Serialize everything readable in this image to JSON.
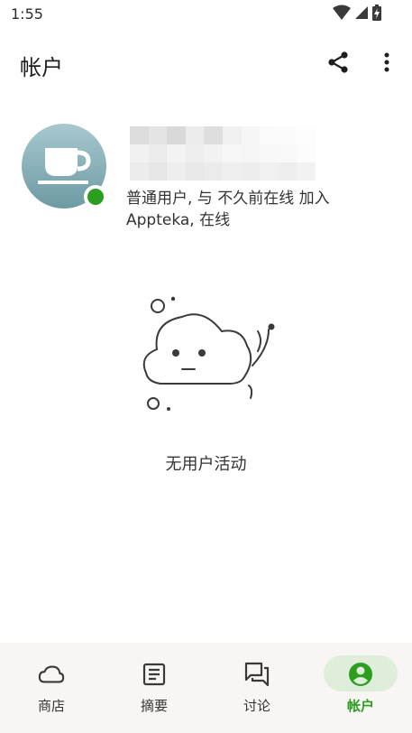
{
  "status_bar": {
    "time": "1:55",
    "icons": [
      "wifi-icon",
      "cell-signal-icon",
      "battery-charging-icon"
    ]
  },
  "app_bar": {
    "title": "帐户",
    "actions": [
      "share-icon",
      "more-vert-icon"
    ]
  },
  "profile": {
    "avatar_icon": "coffee-cup-icon",
    "online": true,
    "name_redacted": true,
    "description": "普通用户, 与 不久前在线 加入 Appteka, 在线"
  },
  "activity": {
    "illustration": "sad-cloud-illustration",
    "empty_message": "无用户活动"
  },
  "bottom_nav": {
    "items": [
      {
        "label": "商店",
        "icon": "cloud-icon",
        "active": false
      },
      {
        "label": "摘要",
        "icon": "feed-icon",
        "active": false
      },
      {
        "label": "讨论",
        "icon": "forum-icon",
        "active": false
      },
      {
        "label": "帐户",
        "icon": "account-circle-icon",
        "active": true
      }
    ]
  },
  "colors": {
    "accent": "#2b9d1f",
    "active_pill": "#dfeedb",
    "nav_background": "#f7f6f4",
    "avatar_top": "#a8c8cf",
    "avatar_bottom": "#6d9aa3"
  }
}
